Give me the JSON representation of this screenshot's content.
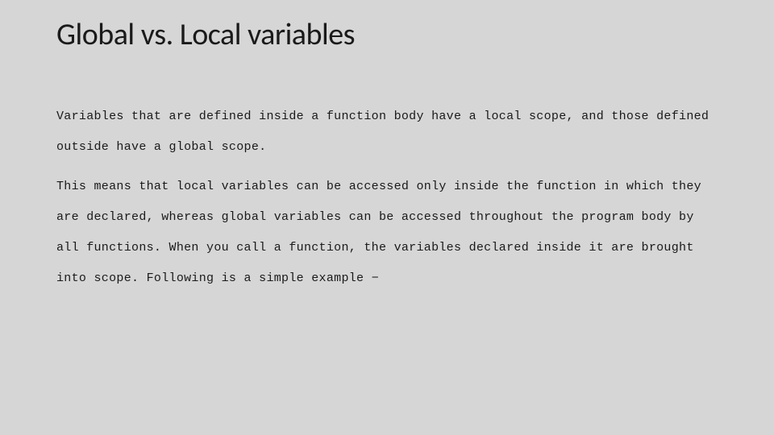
{
  "slide": {
    "title": "Global vs. Local variables",
    "paragraph1": "Variables that are defined inside a function body have a local scope, and those defined outside have a global scope.",
    "paragraph2": "This means that local variables can be accessed only inside the function in which they are declared, whereas global variables can be accessed throughout the program body by all functions. When you call a function, the variables declared inside it are brought into scope. Following is a simple example −"
  }
}
